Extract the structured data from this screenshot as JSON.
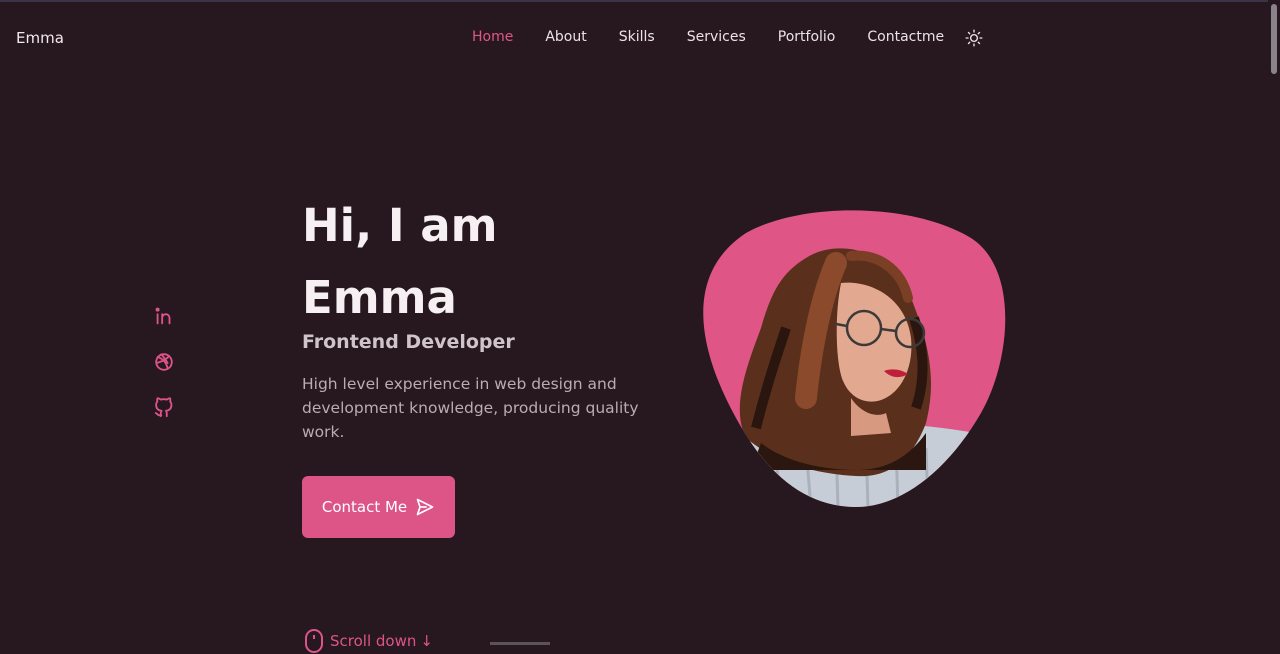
{
  "brand": {
    "name": "Emma",
    "accent": "#dd5487",
    "background": "#26181e"
  },
  "nav": {
    "items": [
      {
        "label": "Home",
        "active": true
      },
      {
        "label": "About",
        "active": false
      },
      {
        "label": "Skills",
        "active": false
      },
      {
        "label": "Services",
        "active": false
      },
      {
        "label": "Portfolio",
        "active": false
      },
      {
        "label": "Contactme",
        "active": false
      }
    ],
    "theme_icon": "sun-icon"
  },
  "socials": [
    {
      "icon": "linkedin-icon"
    },
    {
      "icon": "dribbble-icon"
    },
    {
      "icon": "github-icon"
    }
  ],
  "hero": {
    "title_line1": "Hi, I am",
    "title_line2": "Emma",
    "role": "Frontend Developer",
    "description": "High level experience in web design and development knowledge, producing quality work.",
    "cta_label": "Contact Me",
    "cta_icon": "send-icon",
    "image_icon": "profile-photo"
  },
  "scroll": {
    "label": "Scroll down",
    "icon": "mouse-icon",
    "arrow": "↓"
  }
}
